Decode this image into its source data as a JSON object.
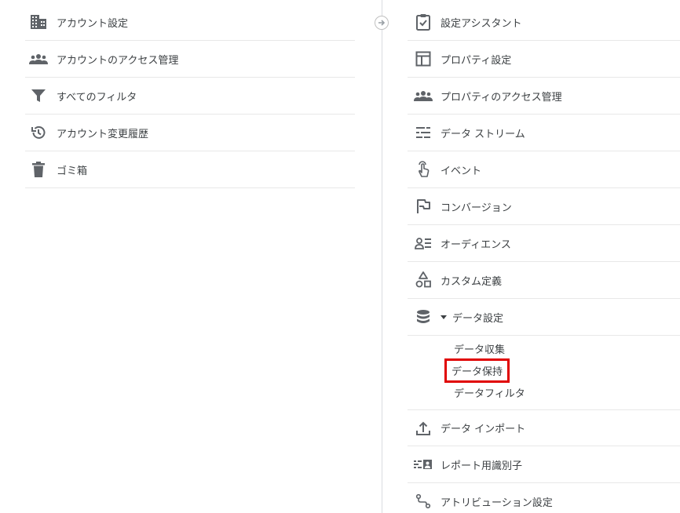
{
  "account_menu": {
    "items": [
      {
        "label": "アカウント設定",
        "icon": "building-icon"
      },
      {
        "label": "アカウントのアクセス管理",
        "icon": "people-icon"
      },
      {
        "label": "すべてのフィルタ",
        "icon": "filter-icon"
      },
      {
        "label": "アカウント変更履歴",
        "icon": "history-icon"
      },
      {
        "label": "ゴミ箱",
        "icon": "trash-icon"
      }
    ]
  },
  "property_menu": {
    "items": [
      {
        "label": "設定アシスタント",
        "icon": "clipboard-check-icon"
      },
      {
        "label": "プロパティ設定",
        "icon": "layout-icon"
      },
      {
        "label": "プロパティのアクセス管理",
        "icon": "people-icon"
      },
      {
        "label": "データ ストリーム",
        "icon": "stream-icon"
      },
      {
        "label": "イベント",
        "icon": "touch-icon"
      },
      {
        "label": "コンバージョン",
        "icon": "flag-icon"
      },
      {
        "label": "オーディエンス",
        "icon": "audience-icon"
      },
      {
        "label": "カスタム定義",
        "icon": "shapes-icon"
      },
      {
        "label": "データ設定",
        "icon": "database-icon"
      },
      {
        "label": "データ インポート",
        "icon": "upload-icon"
      },
      {
        "label": "レポート用識別子",
        "icon": "identifier-icon"
      },
      {
        "label": "アトリビューション設定",
        "icon": "attribution-icon"
      }
    ],
    "data_settings_sub": [
      {
        "label": "データ収集"
      },
      {
        "label": "データ保持",
        "highlighted": true
      },
      {
        "label": "データフィルタ"
      }
    ]
  },
  "colors": {
    "icon": "#5f6368",
    "text": "#3c4043",
    "divider": "#dadce0",
    "highlight_border": "#e00000"
  }
}
